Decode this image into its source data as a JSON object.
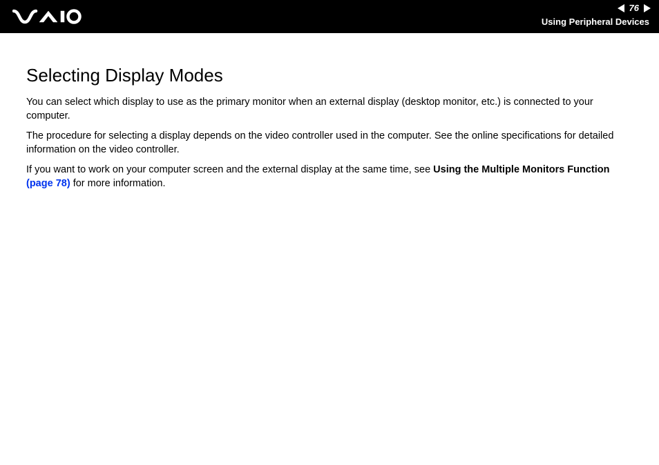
{
  "header": {
    "page_number": "76",
    "section": "Using Peripheral Devices"
  },
  "content": {
    "title": "Selecting Display Modes",
    "p1": "You can select which display to use as the primary monitor when an external display (desktop monitor, etc.) is connected to your computer.",
    "p2": "The procedure for selecting a display depends on the video controller used in the computer. See the online specifications for detailed information on the video controller.",
    "p3a": "If you want to work on your computer screen and the external display at the same time, see ",
    "p3_bold": "Using the Multiple Monitors Function ",
    "p3_link": "(page 78)",
    "p3b": " for more information."
  }
}
